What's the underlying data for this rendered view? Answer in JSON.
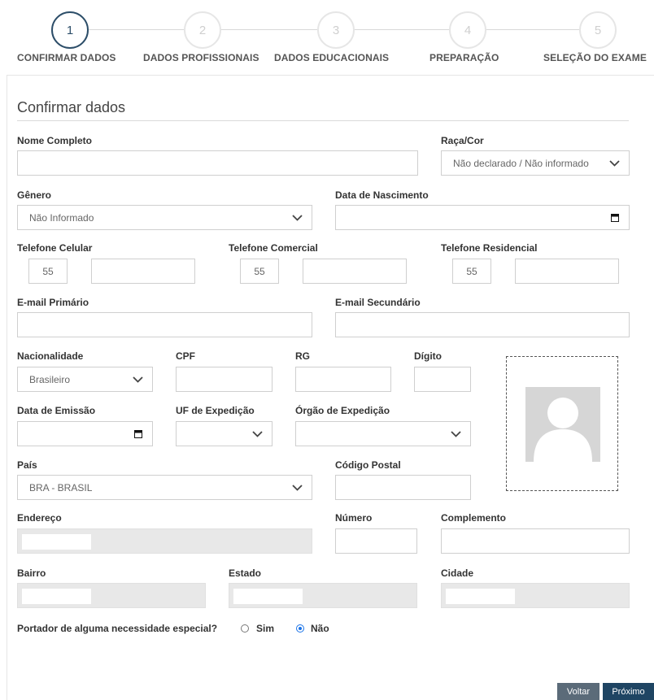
{
  "steps": [
    {
      "number": "1",
      "label": "CONFIRMAR DADOS",
      "active": true
    },
    {
      "number": "2",
      "label": "DADOS PROFISSIONAIS",
      "active": false
    },
    {
      "number": "3",
      "label": "DADOS EDUCACIONAIS",
      "active": false
    },
    {
      "number": "4",
      "label": "PREPARAÇÃO",
      "active": false
    },
    {
      "number": "5",
      "label": "SELEÇÃO DO EXAME",
      "active": false
    }
  ],
  "form": {
    "title": "Confirmar dados",
    "nome_completo": {
      "label": "Nome Completo",
      "value": ""
    },
    "raca_cor": {
      "label": "Raça/Cor",
      "value": "Não declarado / Não informado"
    },
    "genero": {
      "label": "Gênero",
      "value": "Não Informado"
    },
    "data_nascimento": {
      "label": "Data de Nascimento",
      "value": ""
    },
    "telefone_celular": {
      "label": "Telefone Celular",
      "ddi": "55",
      "number": ""
    },
    "telefone_comercial": {
      "label": "Telefone Comercial",
      "ddi": "55",
      "number": ""
    },
    "telefone_residencial": {
      "label": "Telefone Residencial",
      "ddi": "55",
      "number": ""
    },
    "email_primario": {
      "label": "E-mail Primário",
      "value": ""
    },
    "email_secundario": {
      "label": "E-mail Secundário",
      "value": ""
    },
    "nacionalidade": {
      "label": "Nacionalidade",
      "value": "Brasileiro"
    },
    "cpf": {
      "label": "CPF",
      "value": ""
    },
    "rg": {
      "label": "RG",
      "value": ""
    },
    "digito": {
      "label": "Dígito",
      "value": ""
    },
    "data_emissao": {
      "label": "Data de Emissão",
      "value": ""
    },
    "uf_expedicao": {
      "label": "UF de Expedição",
      "value": ""
    },
    "orgao_expedicao": {
      "label": "Órgão de Expedição",
      "value": ""
    },
    "pais": {
      "label": "País",
      "value": "BRA - BRASIL"
    },
    "codigo_postal": {
      "label": "Código Postal",
      "value": ""
    },
    "endereco": {
      "label": "Endereço",
      "value": ""
    },
    "numero": {
      "label": "Número",
      "value": ""
    },
    "complemento": {
      "label": "Complemento",
      "value": ""
    },
    "bairro": {
      "label": "Bairro",
      "value": ""
    },
    "estado": {
      "label": "Estado",
      "value": ""
    },
    "cidade": {
      "label": "Cidade",
      "value": ""
    },
    "necessidade_especial": {
      "question": "Portador de alguma necessidade especial?",
      "options": [
        "Sim",
        "Não"
      ],
      "selected": "Não"
    }
  },
  "buttons": {
    "back": "Voltar",
    "next": "Próximo"
  },
  "colors": {
    "accent": "#1f4563",
    "back_button": "#5b6b79",
    "radio_selected": "#1a73e8"
  }
}
